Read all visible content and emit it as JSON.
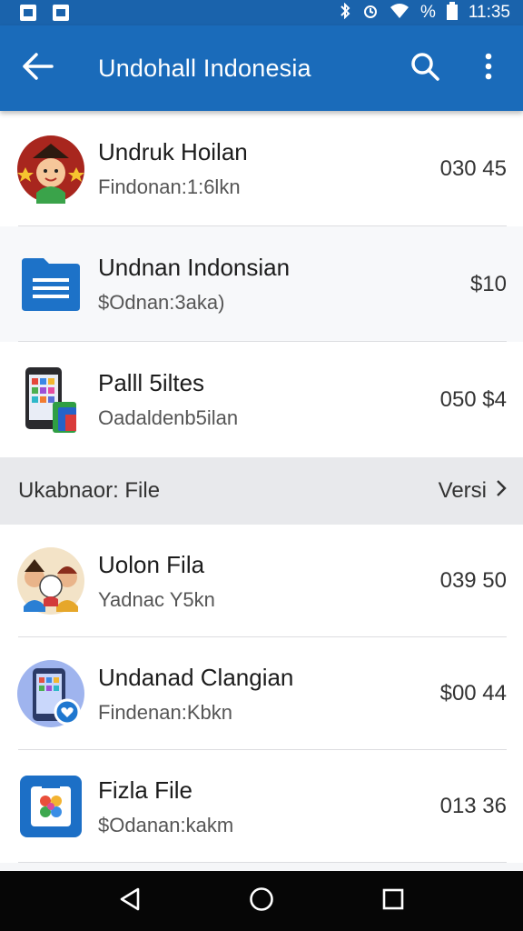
{
  "status_bar": {
    "battery_percent": "%",
    "time": "11:35"
  },
  "app_bar": {
    "title": "Undohall Indonesia"
  },
  "items_top": [
    {
      "title": "Undruk Hoilan",
      "subtitle": "Findonan:1:6lkn",
      "amount": "030 45",
      "icon": "character-avatar-icon"
    },
    {
      "title": "Undnan Indonsian",
      "subtitle": "$Odnan:3aka)",
      "amount": "$10",
      "icon": "document-icon"
    },
    {
      "title": "Palll 5iltes",
      "subtitle": "Oadaldenb5ilan",
      "amount": "050 $4",
      "icon": "phone-apps-icon"
    }
  ],
  "section": {
    "title": "Ukabnaor: File",
    "link_label": "Versi"
  },
  "items_bottom": [
    {
      "title": "Uolon Fila",
      "subtitle": "Yadnac Y5kn",
      "amount": "039 50",
      "icon": "family-avatar-icon"
    },
    {
      "title": "Undanad Clangian",
      "subtitle": "Findenan:Kbkn",
      "amount": "$00 44",
      "icon": "phone-heart-icon"
    },
    {
      "title": "Fizla File",
      "subtitle": "$Odanan:kakm",
      "amount": "013 36",
      "icon": "gallery-app-icon"
    }
  ],
  "colors": {
    "app_bar": "#1a6bba",
    "status_bar": "#1a63ac",
    "nav_bar": "#060606"
  }
}
